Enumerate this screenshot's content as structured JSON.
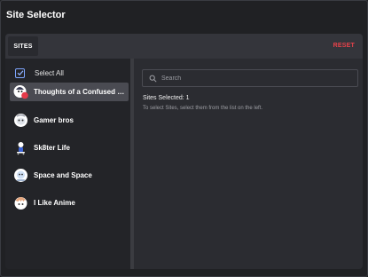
{
  "window": {
    "title": "Site Selector"
  },
  "toolbar": {
    "sites_tab": "SITES",
    "reset_label": "RESET"
  },
  "list": {
    "select_all_label": "Select All",
    "select_all_checked": true,
    "items": [
      {
        "label": "Thoughts of a Confused Mind",
        "selected": true,
        "avatar": "character-avatar-icon"
      },
      {
        "label": "Gamer bros",
        "selected": false,
        "avatar": "character-avatar-icon"
      },
      {
        "label": "Sk8ter Life",
        "selected": false,
        "avatar": "character-avatar-icon"
      },
      {
        "label": "Space and Space",
        "selected": false,
        "avatar": "character-avatar-icon"
      },
      {
        "label": "I Like Anime",
        "selected": false,
        "avatar": "character-avatar-icon"
      }
    ]
  },
  "search": {
    "placeholder": "Search",
    "value": ""
  },
  "details": {
    "selected_text": "Sites Selected: 1",
    "help_text": "To select Sites, select them from the list on the left."
  },
  "colors": {
    "accent": "#7ea6ff",
    "reset": "#e8424a",
    "selected_row": "#4a4b52",
    "badge": "#e53b4a"
  }
}
